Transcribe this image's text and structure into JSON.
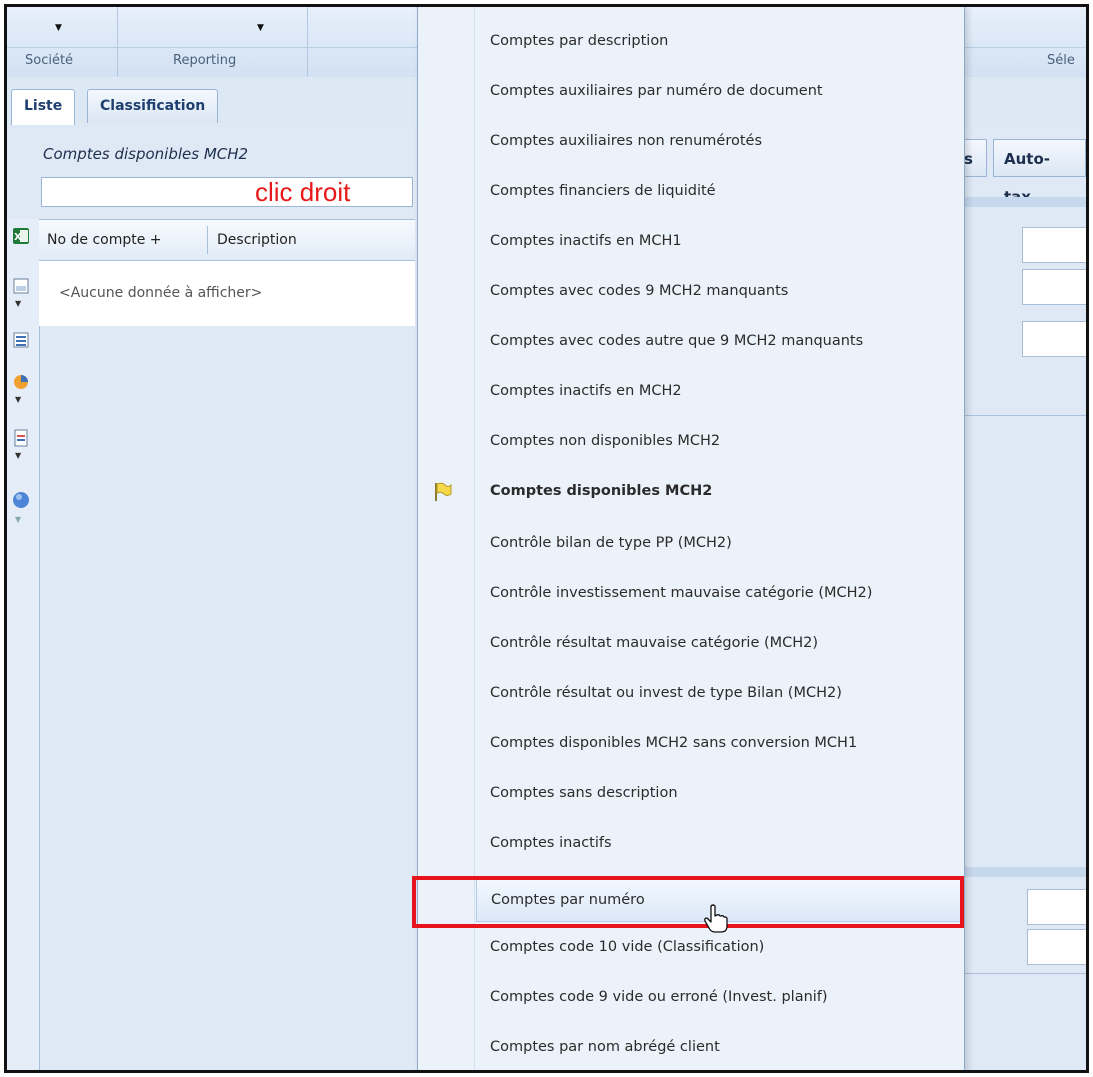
{
  "ribbon": {
    "groups": [
      {
        "label": "Société"
      },
      {
        "label": "Reporting"
      },
      {
        "label": "Séle"
      }
    ]
  },
  "tabs": [
    {
      "label": "Liste",
      "active": true
    },
    {
      "label": "Classification",
      "active": false
    }
  ],
  "panel": {
    "title": "Comptes disponibles MCH2",
    "annotation": "clic droit",
    "columns": [
      "No de compte",
      "Description"
    ],
    "sort_indicator": "+",
    "empty_message": "<Aucune donnée à afficher>"
  },
  "right": {
    "tab_partial": "s",
    "tab_auto": "Auto-tax"
  },
  "menu": {
    "items": [
      {
        "label": "Comptes par description"
      },
      {
        "label": "Comptes auxiliaires par numéro de document"
      },
      {
        "label": "Comptes auxiliaires non renumérotés"
      },
      {
        "label": "Comptes financiers de liquidité"
      },
      {
        "label": "Comptes inactifs en MCH1"
      },
      {
        "label": "Comptes avec codes 9 MCH2 manquants"
      },
      {
        "label": "Comptes avec codes autre que 9 MCH2 manquants"
      },
      {
        "label": "Comptes inactifs en MCH2"
      },
      {
        "label": "Comptes non disponibles MCH2"
      },
      {
        "label": "Comptes disponibles MCH2",
        "current": true
      },
      {
        "label": "Contrôle bilan de type PP (MCH2)"
      },
      {
        "label": "Contrôle investissement mauvaise catégorie (MCH2)"
      },
      {
        "label": "Contrôle résultat mauvaise catégorie (MCH2)"
      },
      {
        "label": "Contrôle résultat ou invest de type Bilan (MCH2)"
      },
      {
        "label": "Comptes disponibles MCH2 sans conversion MCH1"
      },
      {
        "label": "Comptes sans description"
      },
      {
        "label": "Comptes inactifs"
      },
      {
        "label": "Comptes par numéro",
        "hovered": true
      },
      {
        "label": "Comptes code 10 vide (Classification)"
      },
      {
        "label": "Comptes code 9 vide ou erroné (Invest. planif)"
      },
      {
        "label": "Comptes par nom abrégé client"
      }
    ]
  },
  "colors": {
    "highlight": "#e8141b",
    "annotation": "#e81919"
  }
}
